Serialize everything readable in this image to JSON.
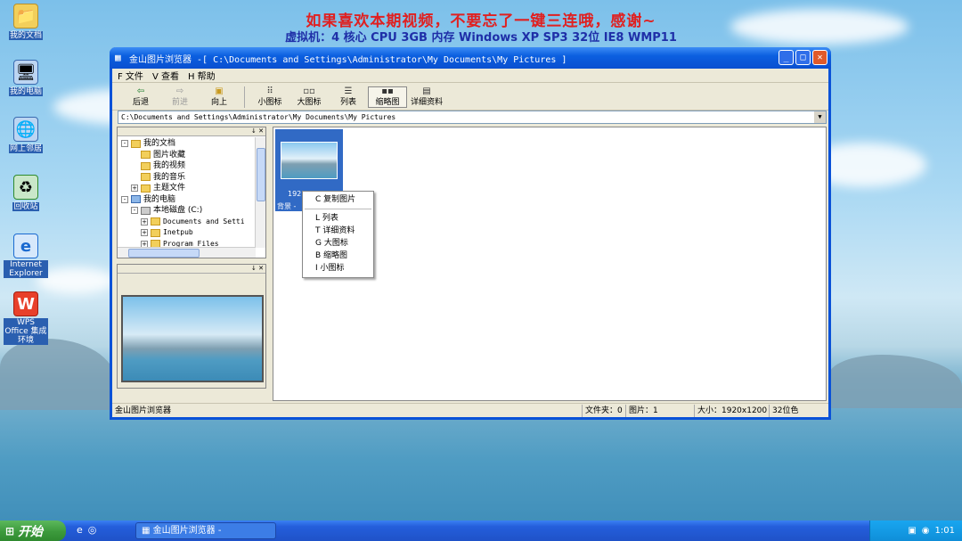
{
  "banner": {
    "line1": "如果喜欢本期视频，不要忘了一键三连哦，感谢~",
    "line2": "虚拟机：4 核心 CPU    3GB 内存    Windows XP SP3 32位    IE8    WMP11"
  },
  "desktop_icons": [
    {
      "label": "我的文档",
      "icon": "folder-icon"
    },
    {
      "label": "我的电脑",
      "icon": "computer-icon"
    },
    {
      "label": "网上邻居",
      "icon": "network-icon"
    },
    {
      "label": "回收站",
      "icon": "recycle-bin-icon"
    },
    {
      "label": "Internet Explorer",
      "icon": "ie-icon"
    },
    {
      "label": "WPS Office 集成环境",
      "icon": "wps-icon"
    }
  ],
  "window": {
    "title": "金山图片浏览器 -[ C:\\Documents and Settings\\Administrator\\My Documents\\My Pictures ]",
    "menu": [
      "F 文件",
      "V 查看",
      "H 帮助"
    ],
    "toolbar": [
      {
        "label": "后退",
        "icon": "back-arrow-icon",
        "state": "enabled"
      },
      {
        "label": "前进",
        "icon": "forward-arrow-icon",
        "state": "disabled"
      },
      {
        "label": "向上",
        "icon": "up-folder-icon",
        "state": "enabled"
      },
      {
        "label": "小图标",
        "icon": "small-icons-icon",
        "state": "enabled"
      },
      {
        "label": "大图标",
        "icon": "large-icons-icon",
        "state": "enabled"
      },
      {
        "label": "列表",
        "icon": "list-icon",
        "state": "enabled"
      },
      {
        "label": "缩略图",
        "icon": "thumbnails-icon",
        "state": "active"
      },
      {
        "label": "详细资料",
        "icon": "details-icon",
        "state": "enabled"
      }
    ],
    "address": "C:\\Documents and Settings\\Administrator\\My Documents\\My Pictures",
    "tree": [
      {
        "label": "我的文档",
        "indent": 0,
        "expander": "-",
        "kind": "folder"
      },
      {
        "label": "图片收藏",
        "indent": 2,
        "expander": "",
        "kind": "folder"
      },
      {
        "label": "我的视频",
        "indent": 2,
        "expander": "",
        "kind": "folder"
      },
      {
        "label": "我的音乐",
        "indent": 2,
        "expander": "",
        "kind": "folder"
      },
      {
        "label": "主题文件",
        "indent": 1,
        "expander": "+",
        "kind": "folder"
      },
      {
        "label": "我的电脑",
        "indent": 0,
        "expander": "-",
        "kind": "pc"
      },
      {
        "label": "本地磁盘 (C:)",
        "indent": 1,
        "expander": "-",
        "kind": "pc"
      },
      {
        "label": "Documents and Setti",
        "indent": 2,
        "expander": "+",
        "kind": "folder"
      },
      {
        "label": "Inetpub",
        "indent": 2,
        "expander": "+",
        "kind": "folder"
      },
      {
        "label": "Program Files",
        "indent": 2,
        "expander": "+",
        "kind": "folder"
      }
    ],
    "thumbnail": {
      "caption": "192",
      "caption2": "背景 -"
    },
    "context_menu": [
      {
        "label": "C 复制图片"
      },
      {
        "separator": true
      },
      {
        "label": "L 列表"
      },
      {
        "label": "T 详细资料"
      },
      {
        "label": "G 大图标"
      },
      {
        "label": "B 缩略图"
      },
      {
        "label": "I 小图标"
      }
    ],
    "status": {
      "app": "金山图片浏览器",
      "folders": "文件夹：0",
      "images": "图片：1",
      "size": "大小：1920x1200",
      "depth": "32位色"
    }
  },
  "taskbar": {
    "start_label": "开始",
    "task_label": "金山图片浏览器 -",
    "clock": "1:01"
  }
}
